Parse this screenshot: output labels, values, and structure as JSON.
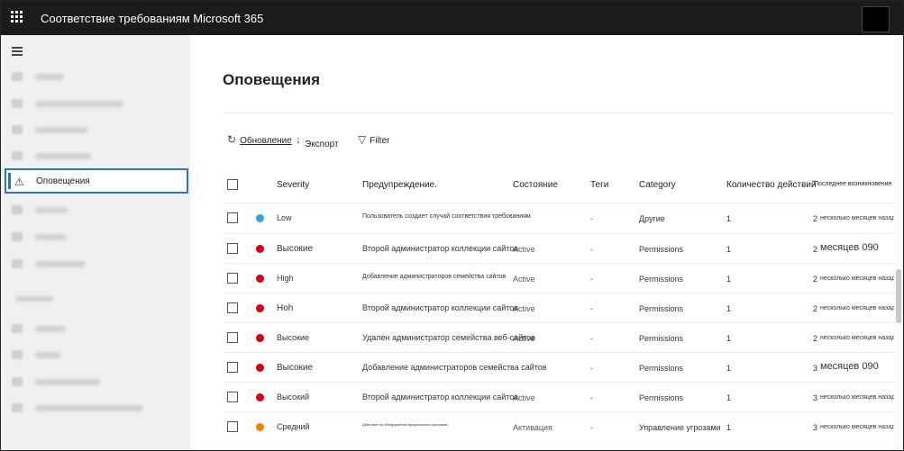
{
  "app": {
    "title": "Соответствие требованиям Microsoft 365"
  },
  "sidebar": {
    "active_item": {
      "label": "Оповещения",
      "icon": "warning-icon"
    }
  },
  "page": {
    "title": "Оповещения"
  },
  "toolbar": {
    "refresh_label": "Обновление",
    "export_label": "Экспорт",
    "filter_label": "Filter"
  },
  "table": {
    "columns": [
      "Severity",
      "Предупреждение.",
      "Состояние",
      "Теги",
      "Category",
      "Количество действий",
      "Последнее возникновение"
    ],
    "rows": [
      {
        "color": "#29a8e0",
        "severity": "Low",
        "alert": "Пользователь создает случай соответствия требованиям",
        "status": "",
        "tags": "-",
        "category": "Другие",
        "count": "1",
        "last_num": "2",
        "last": "несколько месяцев назад"
      },
      {
        "color": "#d0021b",
        "severity": "Высокие",
        "alert": "Второй администратор коллекции сайтов",
        "status": "Active",
        "tags": "-",
        "category": "Permissions",
        "count": "1",
        "last_num": "2",
        "last": "месяцев 090"
      },
      {
        "color": "#d0021b",
        "severity": "High",
        "alert": "Добавление администраторов семейства сайтов",
        "status": "Active",
        "tags": "-",
        "category": "Permissions",
        "count": "1",
        "last_num": "2",
        "last": "несколько месяцев назад"
      },
      {
        "color": "#d0021b",
        "severity": "Hoh",
        "alert": "Второй администратор коллекции сайтов",
        "status": "Active",
        "tags": "-",
        "category": "Permissions",
        "count": "1",
        "last_num": "2",
        "last": "несколько месяцев назад"
      },
      {
        "color": "#d0021b",
        "severity": "Высокие",
        "alert": "Удален администратор семейства веб-сайтов",
        "status": "Active",
        "tags": "-",
        "category": "Permissions",
        "count": "1",
        "last_num": "2",
        "last": "несколько месяцев назад"
      },
      {
        "color": "#d0021b",
        "severity": "Высокие",
        "alert": "Добавление администраторов семейства сайтов",
        "status": "",
        "tags": "-",
        "category": "Permissions",
        "count": "1",
        "last_num": "3",
        "last": "месяцев 090"
      },
      {
        "color": "#d0021b",
        "severity": "Высокий",
        "alert": "Второй администратор коллекции сайтов",
        "status": "Active",
        "tags": "-",
        "category": "Permissions",
        "count": "1",
        "last_num": "3",
        "last": "несколько месяцев назад"
      },
      {
        "color": "#f0820f",
        "severity": "Средний",
        "alert": "Действие по обнаружению вредоносных программ",
        "status": "Активация",
        "tags": "-",
        "category": "Управление угрозами",
        "count": "1",
        "last_num": "3",
        "last": "несколько месяцев назад"
      }
    ]
  }
}
